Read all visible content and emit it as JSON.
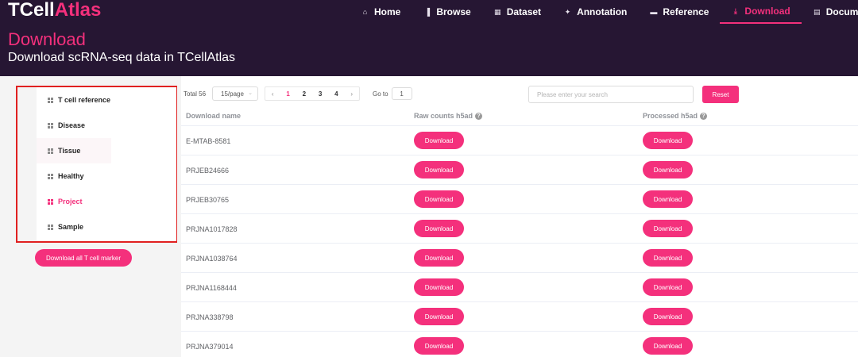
{
  "brand": {
    "part1": "TCell",
    "part2": "Atlas"
  },
  "nav": [
    {
      "label": "Home",
      "icon": "home-icon",
      "glyph": "⌂",
      "active": false
    },
    {
      "label": "Browse",
      "icon": "bar-chart-icon",
      "glyph": "▐",
      "active": false
    },
    {
      "label": "Dataset",
      "icon": "grid-icon",
      "glyph": "▦",
      "active": false
    },
    {
      "label": "Annotation",
      "icon": "annotation-icon",
      "glyph": "✦",
      "active": false
    },
    {
      "label": "Reference",
      "icon": "monitor-icon",
      "glyph": "▬",
      "active": false
    },
    {
      "label": "Download",
      "icon": "download-icon",
      "glyph": "⤓",
      "active": true
    },
    {
      "label": "Document",
      "icon": "document-icon",
      "glyph": "▤",
      "active": false
    }
  ],
  "hero": {
    "title": "Download",
    "subtitle": "Download scRNA-seq data in TCellAtlas"
  },
  "sidebar": {
    "items": [
      {
        "label": "T cell reference",
        "active": false
      },
      {
        "label": "Disease",
        "active": false
      },
      {
        "label": "Tissue",
        "active": false
      },
      {
        "label": "Healthy",
        "active": false
      },
      {
        "label": "Project",
        "active": true
      },
      {
        "label": "Sample",
        "active": false
      }
    ],
    "download_all_label": "Download all T cell marker"
  },
  "pagination": {
    "total_label": "Total 56",
    "page_size": "15/page",
    "prev": "‹",
    "next": "›",
    "pages": [
      "1",
      "2",
      "3",
      "4"
    ],
    "current_page": "1",
    "goto_label": "Go to",
    "goto_value": "1"
  },
  "search": {
    "placeholder": "Please enter your search",
    "value": ""
  },
  "reset_label": "Reset",
  "table": {
    "columns": [
      "Download name",
      "Raw counts h5ad",
      "Processed h5ad"
    ],
    "info_glyph": "?",
    "button_label": "Download",
    "rows": [
      "E-MTAB-8581",
      "PRJEB24666",
      "PRJEB30765",
      "PRJNA1017828",
      "PRJNA1038764",
      "PRJNA1168444",
      "PRJNA338798",
      "PRJNA379014"
    ]
  },
  "colors": {
    "accent": "#f4307c",
    "header_bg": "#261633",
    "highlight_border": "#e02020"
  }
}
